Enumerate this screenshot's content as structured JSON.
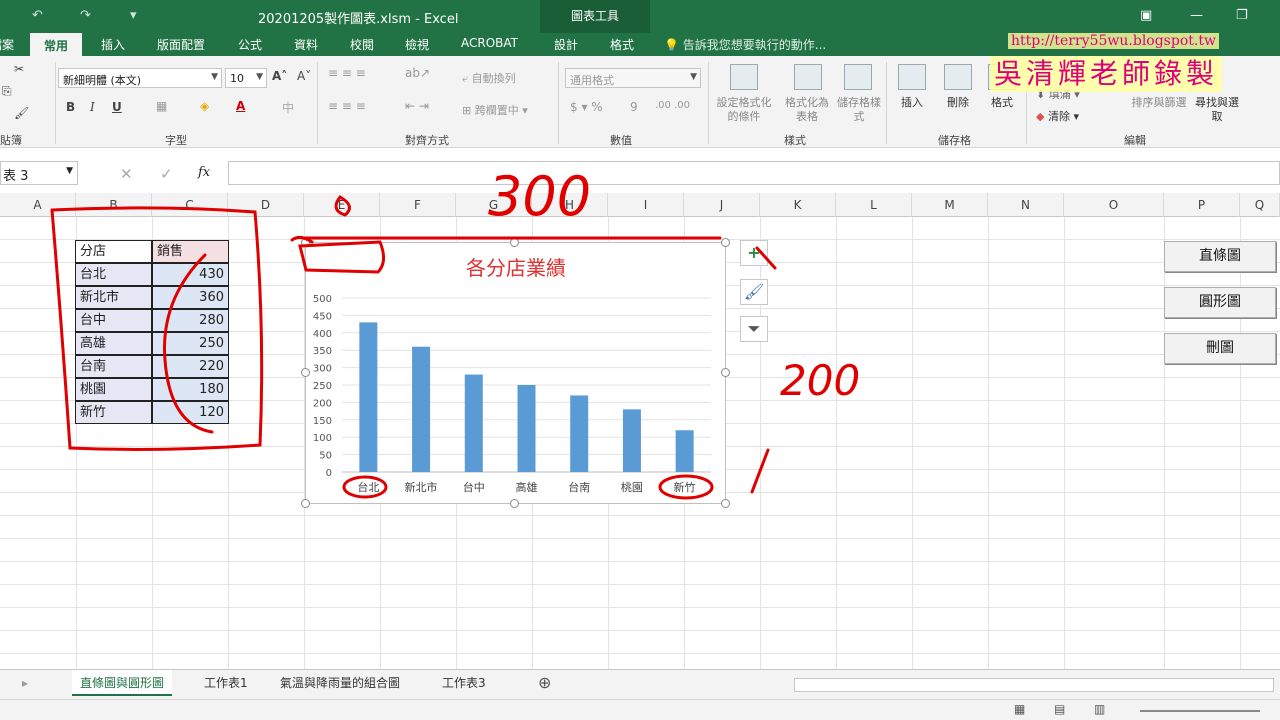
{
  "window": {
    "title": "20201205製作圖表.xlsm - Excel",
    "context_tab_group": "圖表工具"
  },
  "ribbon_tabs": [
    "檔案",
    "常用",
    "插入",
    "版面配置",
    "公式",
    "資料",
    "校閱",
    "檢視",
    "ACROBAT",
    "設計",
    "格式"
  ],
  "tell_me": "告訴我您想要執行的動作...",
  "ribbon": {
    "font_name": "新細明體 (本文)",
    "font_size": "10",
    "number_format": "通用格式",
    "group_labels": {
      "clipboard": "貼簿",
      "font": "字型",
      "alignment": "對齊方式",
      "number": "數值",
      "styles": "樣式",
      "cells": "儲存格",
      "editing": "編輯"
    },
    "wrap_text": "自動換列",
    "merge_center": "跨欄置中",
    "cond_format": "設定格式化的條件",
    "format_as_table": "格式化為表格",
    "cell_styles": "儲存格樣式",
    "insert": "插入",
    "delete": "刪除",
    "format": "格式",
    "fill": "填滿",
    "clear": "清除",
    "sort_filter": "排序與篩選",
    "find_select": "尋找與選取"
  },
  "name_box": "表 3",
  "fx": "fx",
  "columns": [
    "A",
    "B",
    "C",
    "D",
    "E",
    "F",
    "G",
    "H",
    "I",
    "J",
    "K",
    "L",
    "M",
    "N",
    "O",
    "P",
    "Q"
  ],
  "table": {
    "headers": [
      "分店",
      "銷售"
    ],
    "rows": [
      [
        "台北",
        "430"
      ],
      [
        "新北市",
        "360"
      ],
      [
        "台中",
        "280"
      ],
      [
        "高雄",
        "250"
      ],
      [
        "台南",
        "220"
      ],
      [
        "桃園",
        "180"
      ],
      [
        "新竹",
        "120"
      ]
    ]
  },
  "chart_data": {
    "type": "bar",
    "title": "各分店業績",
    "categories": [
      "台北",
      "新北市",
      "台中",
      "高雄",
      "台南",
      "桃園",
      "新竹"
    ],
    "values": [
      430,
      360,
      280,
      250,
      220,
      180,
      120
    ],
    "ylim": [
      0,
      500
    ],
    "yticks": [
      "0",
      "50",
      "100",
      "150",
      "200",
      "250",
      "300",
      "350",
      "400",
      "450",
      "500"
    ],
    "grid": true,
    "bar_color": "#5b9bd5",
    "title_color": "#e03030"
  },
  "chart_side_buttons": [
    "add-element",
    "style",
    "filter"
  ],
  "macro_buttons": [
    "直條圖",
    "圓形圖",
    "刪圖"
  ],
  "sheet_tabs": [
    "直條圖與圓形圖",
    "工作表1",
    "氣溫與降雨量的組合圖",
    "工作表3"
  ],
  "annotations": {
    "top": "300",
    "right": "200"
  },
  "watermark": {
    "url": "http://terry55wu.blogspot.tw",
    "author": "吳清輝老師錄製"
  },
  "colors": {
    "excel_green": "#217346",
    "annotation_red": "#e00000",
    "watermark_pink": "#e0007a"
  }
}
